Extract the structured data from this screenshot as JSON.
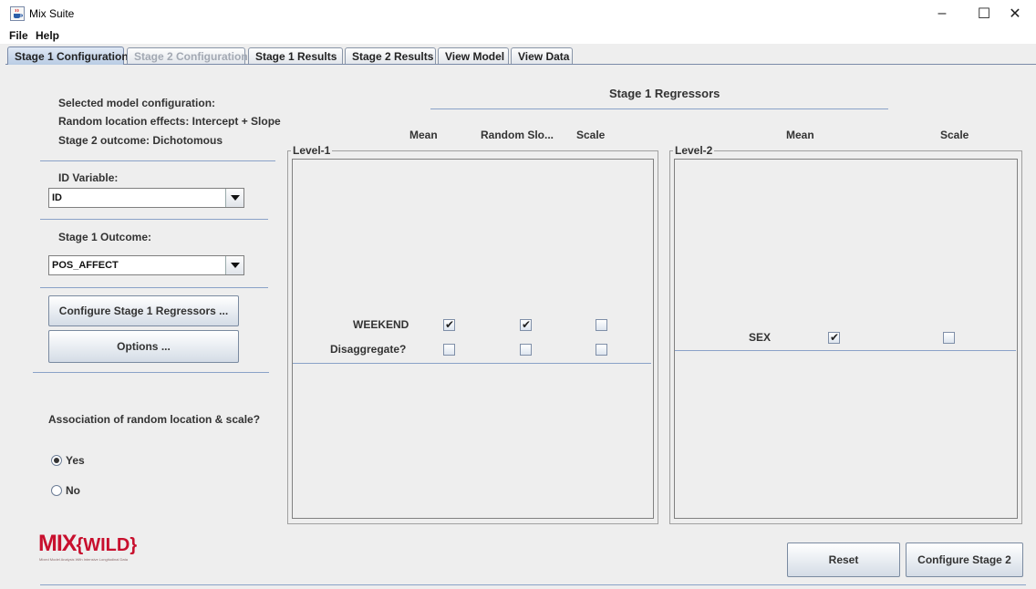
{
  "window": {
    "title": "Mix Suite",
    "controls": {
      "minimize": "–",
      "maximize": "☐",
      "close": "✕"
    }
  },
  "menu": [
    "File",
    "Help"
  ],
  "tabs": [
    {
      "label": "Stage 1 Configuration",
      "state": "active"
    },
    {
      "label": "Stage 2 Configuration",
      "state": "disabled"
    },
    {
      "label": "Stage 1 Results",
      "state": "normal"
    },
    {
      "label": "Stage 2 Results",
      "state": "normal"
    },
    {
      "label": "View Model",
      "state": "normal"
    },
    {
      "label": "View Data",
      "state": "normal"
    }
  ],
  "left": {
    "config_lines": [
      "Selected model configuration:",
      "Random location effects: Intercept + Slope",
      "Stage 2 outcome: Dichotomous"
    ],
    "id_variable": {
      "label": "ID Variable:",
      "value": "ID"
    },
    "stage1_outcome": {
      "label": "Stage 1 Outcome:",
      "value": "POS_AFFECT"
    },
    "configure_button": "Configure Stage 1 Regressors ...",
    "options_button": "Options ...",
    "association": {
      "question": "Association of random location & scale?",
      "yes": "Yes",
      "no": "No",
      "selected": "Yes"
    },
    "logo": {
      "text_main": "MIX",
      "text_brace": "{WILD}",
      "tagline": "Mixed Model Analysis With Intensive Longitudinal Data"
    }
  },
  "right": {
    "title": "Stage 1 Regressors",
    "level1": {
      "title": "Level-1",
      "headers": [
        "Mean",
        "Random Slo...",
        "Scale"
      ],
      "rows": [
        {
          "label": "WEEKEND",
          "checks": [
            true,
            true,
            false
          ]
        },
        {
          "label": "Disaggregate?",
          "checks": [
            false,
            false,
            false
          ]
        }
      ]
    },
    "level2": {
      "title": "Level-2",
      "headers": [
        "Mean",
        "Scale"
      ],
      "rows": [
        {
          "label": "SEX",
          "checks": [
            true,
            false
          ]
        }
      ]
    },
    "reset_button": "Reset",
    "configure_stage2_button": "Configure Stage 2"
  },
  "colors": {
    "accent_line": "#8aa2c8",
    "logo_red": "#c8102e",
    "tab_active": "#b9cce4"
  },
  "icons": {
    "app": "java-cup-icon",
    "dropdown": "chevron-down-icon",
    "check": "checkmark-icon"
  }
}
